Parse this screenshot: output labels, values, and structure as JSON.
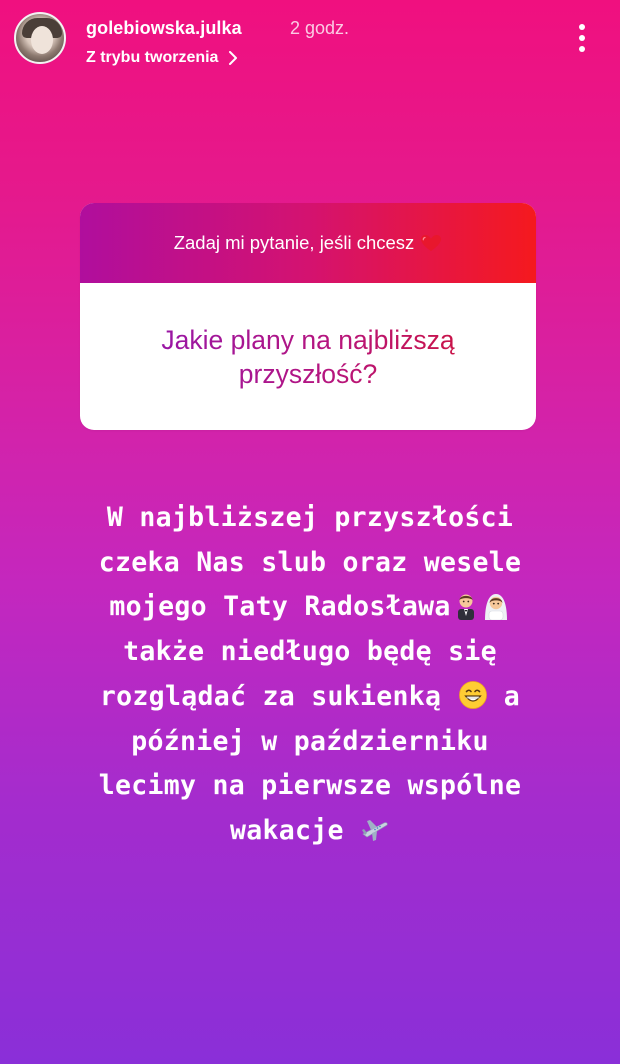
{
  "header": {
    "username": "golebiowska.julka",
    "time": "2 godz.",
    "create_mode": "Z trybu tworzenia"
  },
  "question_box": {
    "prompt": "Zadaj mi pytanie, jeśli chcesz",
    "prompt_icon": "red-heart-icon",
    "question": "Jakie plany na najbliższą przyszłość?"
  },
  "answer": {
    "lines": [
      "W najbliższej przyszłości",
      "czeka Nas slub oraz wesele",
      "mojego Taty Radosława",
      "także niedługo będę się",
      "rozglądać za sukienką",
      "a",
      "później w październiku",
      "lecimy na pierwsze wspólne",
      "wakacje"
    ],
    "emojis": [
      "groom-emoji",
      "bride-emoji",
      "grinning-face-emoji",
      "airplane-emoji"
    ]
  },
  "colors": {
    "background_top": "#f0107f",
    "background_bottom": "#8a2fd8",
    "box_header_left": "#b00e9d",
    "box_header_right": "#f5191e"
  }
}
